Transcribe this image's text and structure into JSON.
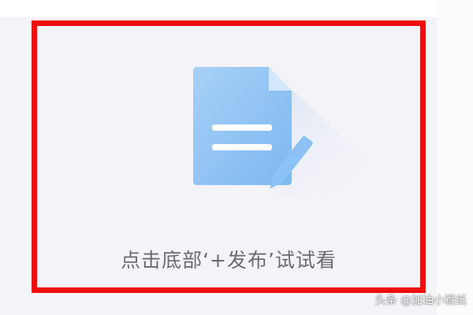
{
  "empty_state": {
    "icon": "document-edit-icon",
    "message": "点击底部‘+发布’试试看"
  },
  "watermark": {
    "text": "头条 @加油小猴纸"
  },
  "colors": {
    "highlight_border": "#ee0d0d",
    "background": "#f4f3f8",
    "doc_blue": "#8ec3f4",
    "doc_blue_light": "#c9e3fb",
    "text_gray": "#6b6b6f"
  }
}
